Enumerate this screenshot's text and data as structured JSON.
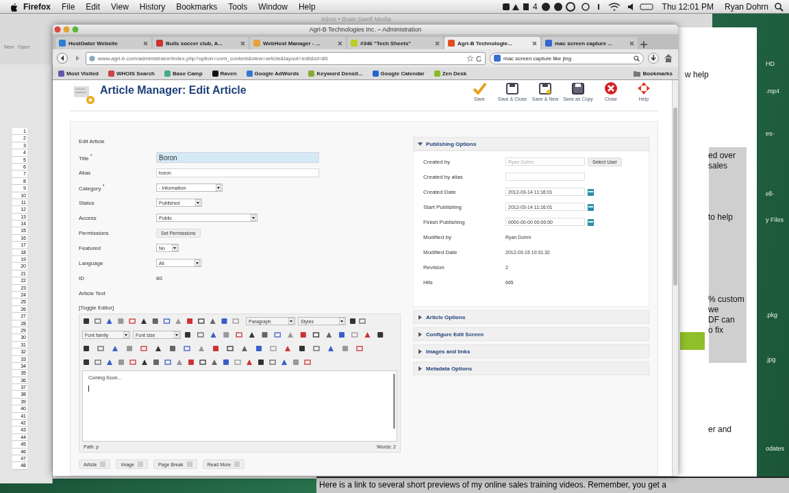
{
  "menu_bar": {
    "app": "Firefox",
    "items": [
      "File",
      "Edit",
      "View",
      "History",
      "Bookmarks",
      "Tools",
      "Window",
      "Help"
    ],
    "status_badge": "4",
    "clock": "Thu 12:01 PM",
    "user": "Ryan Dohrn"
  },
  "background": {
    "mail_title": "Inbox • Brain Swell Media",
    "mail_toolbar": [
      "New",
      "Open"
    ],
    "spreadsheet_rows": [
      "1",
      "2",
      "3",
      "4",
      "5",
      "6",
      "7",
      "8",
      "9",
      "10",
      "11",
      "12",
      "13",
      "14",
      "15",
      "16",
      "17",
      "18",
      "19",
      "20",
      "21",
      "22",
      "23",
      "24",
      "25",
      "26",
      "27",
      "28",
      "29",
      "30",
      "31",
      "32",
      "33",
      "34",
      "35",
      "36",
      "37",
      "38",
      "39",
      "40",
      "41",
      "42",
      "43",
      "44",
      "45",
      "46",
      "47",
      "48"
    ],
    "document_fragments": [
      "w help",
      "ed over",
      "sales",
      "to help",
      "% custom",
      "we",
      "DF can",
      "o fix",
      "er and"
    ],
    "desktop_labels": [
      "HD",
      ".mp4",
      "es-",
      "ell-",
      "y Files",
      ".pkg",
      ".jpg",
      "odates"
    ],
    "caption": "Here is a link to several short previews of my online sales training videos.  Remember, you get a"
  },
  "browser": {
    "title": "Agri-B Technologies Inc. – Administration",
    "tabs": [
      {
        "label": "HostGator Website",
        "selected": false
      },
      {
        "label": "Bulls soccer club, A...",
        "selected": false
      },
      {
        "label": "WebHost Manager - ...",
        "selected": false
      },
      {
        "label": "#346 \"Tech Sheets\"",
        "selected": false
      },
      {
        "label": "Agri-B Technologie...",
        "selected": true
      },
      {
        "label": "mac screen capture ...",
        "selected": false
      }
    ],
    "url": "www.agri-b.com/administrator/index.php?option=com_content&view=article&layout=edit&id=80",
    "search": "mac screen capture like jing",
    "bookmarks": [
      "Most Visited",
      "WHOIS Search",
      "Base Camp",
      "Raven",
      "Google AdWords",
      "Keyword Densit...",
      "Google Calendar",
      "Zen Desk"
    ],
    "bookmarks_menu": "Bookmarks"
  },
  "page": {
    "title": "Article Manager: Edit Article",
    "toolbar": [
      {
        "label": "Save",
        "kind": "save"
      },
      {
        "label": "Save & Close",
        "kind": "disk"
      },
      {
        "label": "Save & New",
        "kind": "disk-new"
      },
      {
        "label": "Save as Copy",
        "kind": "disk-copy"
      },
      {
        "label": "Close",
        "kind": "close"
      },
      {
        "label": "Help",
        "kind": "help"
      }
    ],
    "form": {
      "legend": "Edit Article",
      "fields": [
        {
          "label": "Title $^{*}$",
          "kind": "text",
          "value": "Boron",
          "focused": true
        },
        {
          "label": "Alias",
          "kind": "text",
          "value": "boron",
          "focused": false
        },
        {
          "label": "Category $^{*}$",
          "kind": "select",
          "value": "- Information"
        },
        {
          "label": "Status",
          "kind": "select",
          "value": "Published"
        },
        {
          "label": "Access",
          "kind": "select",
          "value": "Public"
        },
        {
          "label": "Permissions",
          "kind": "button",
          "value": "Set Permissions"
        },
        {
          "label": "Featured",
          "kind": "select",
          "value": "No"
        },
        {
          "label": "Language",
          "kind": "select",
          "value": "All"
        },
        {
          "label": "ID",
          "kind": "static",
          "value": "80"
        },
        {
          "label": "Article Text",
          "kind": "label"
        }
      ]
    },
    "editor": {
      "toggle": "[Toggle Editor]",
      "selects": [
        "Paragraph",
        "Styles",
        "Font family",
        "Font size"
      ],
      "content": "Coming Soon...",
      "path": "Path: p",
      "words": "Words: 2",
      "buttons": [
        "Article",
        "Image",
        "Page Break",
        "Read More"
      ]
    },
    "publishing": {
      "title": "Publishing Options",
      "expanded": true,
      "fields": [
        {
          "label": "Created by",
          "kind": "user",
          "value": "Ryan Dohrn",
          "button": "Select User"
        },
        {
          "label": "Created by alias",
          "kind": "text"
        },
        {
          "label": "Created Date",
          "kind": "date",
          "value": "2012-03-14 11:16:01"
        },
        {
          "label": "Start Publishing",
          "kind": "date",
          "value": "2012-03-14 11:16:01"
        },
        {
          "label": "Finish Publishing",
          "kind": "date",
          "value": "0000-00-00 00:00:00"
        },
        {
          "label": "Modified by",
          "kind": "static",
          "value": "Ryan Dohrn"
        },
        {
          "label": "Modified Date",
          "kind": "static",
          "value": "2012-03-15 10:31:32"
        },
        {
          "label": "Revision",
          "kind": "static",
          "value": "2"
        },
        {
          "label": "Hits",
          "kind": "static",
          "value": "665"
        }
      ]
    },
    "panels": [
      {
        "title": "Article Options",
        "expanded": false
      },
      {
        "title": "Configure Edit Screen",
        "expanded": false
      },
      {
        "title": "Images and links",
        "expanded": false
      },
      {
        "title": "Metadata Options",
        "expanded": false
      }
    ]
  }
}
